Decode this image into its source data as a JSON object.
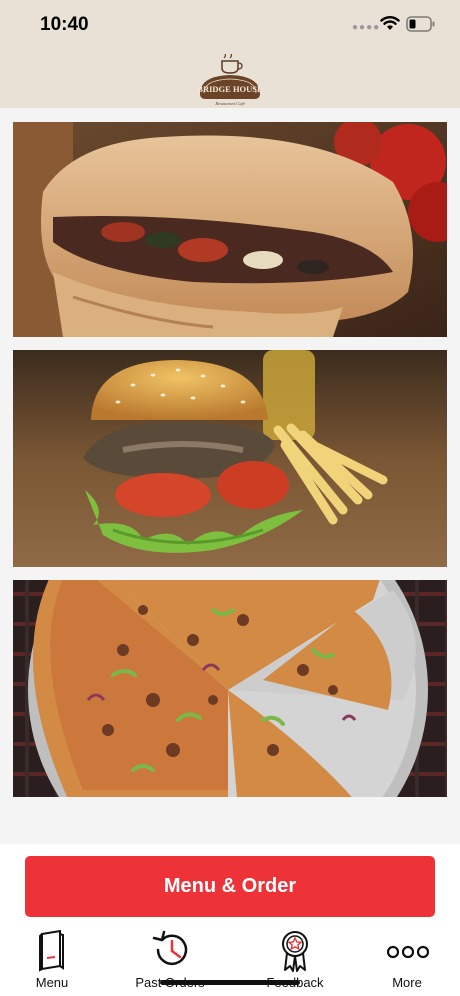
{
  "status_bar": {
    "time": "10:40"
  },
  "header": {
    "logo_name": "BRIDGE HOUSE",
    "logo_tagline": "Restaurant Café"
  },
  "cards": [
    {
      "name": "calzone",
      "icon": "calzone-image"
    },
    {
      "name": "burger",
      "icon": "burger-image"
    },
    {
      "name": "pizza",
      "icon": "pizza-image"
    }
  ],
  "cta": {
    "label": "Menu & Order"
  },
  "tabs": [
    {
      "label": "Menu",
      "icon": "menu-book-icon"
    },
    {
      "label": "Past Orders",
      "icon": "history-clock-icon"
    },
    {
      "label": "Feedback",
      "icon": "award-ribbon-icon"
    },
    {
      "label": "More",
      "icon": "more-dots-icon"
    }
  ],
  "colors": {
    "accent": "#ee3338",
    "header_bg": "#e9e1d6"
  }
}
